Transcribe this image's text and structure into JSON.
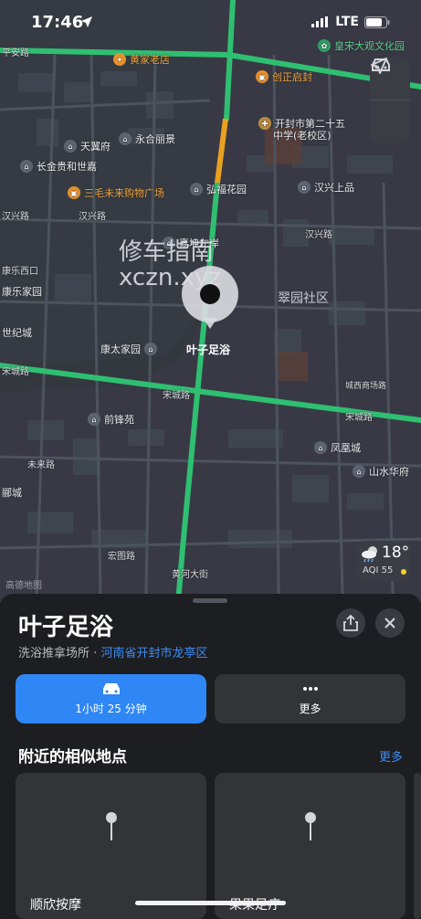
{
  "status_bar": {
    "time": "17:46",
    "network": "LTE"
  },
  "map": {
    "watermark_line1": "修车指南",
    "watermark_line2": "xczn.xyz",
    "pin_label": "叶子足浴",
    "legal": "高德地图",
    "pois": [
      {
        "label": "黄家老店",
        "style": "orange"
      },
      {
        "label": "皇宋大观文化园",
        "style": "green"
      },
      {
        "label": "创正启封",
        "style": "orange"
      },
      {
        "label": "开封市第二十五",
        "style": "normal"
      },
      {
        "label": "中学(老校区)",
        "style": "normal"
      },
      {
        "label": "天翼府",
        "style": "normal"
      },
      {
        "label": "永合丽景",
        "style": "normal"
      },
      {
        "label": "长金贵和世嘉",
        "style": "normal"
      },
      {
        "label": "三毛未来购物广场",
        "style": "orange"
      },
      {
        "label": "弘福花园",
        "style": "normal"
      },
      {
        "label": "汉兴上品",
        "style": "normal"
      },
      {
        "label": "嘉坤左岸",
        "style": "normal"
      },
      {
        "label": "康乐家园",
        "style": "normal"
      },
      {
        "label": "世纪城",
        "style": "normal"
      },
      {
        "label": "康太家园",
        "style": "normal"
      },
      {
        "label": "前锋苑",
        "style": "normal"
      },
      {
        "label": "凤凰城",
        "style": "normal"
      },
      {
        "label": "山水华府",
        "style": "normal"
      },
      {
        "label": "郦城",
        "style": "normal"
      }
    ],
    "roads": [
      "平安路",
      "汉兴路",
      "汉兴路",
      "康乐西口",
      "宋城路",
      "宋城路",
      "宋城路",
      "城西商场路",
      "未来路",
      "黄河大街",
      "宏图路",
      "汉兴路"
    ],
    "areas": [
      "翠园社区"
    ],
    "weather": {
      "temp": "18°",
      "aqi": "AQI 55"
    }
  },
  "sheet": {
    "title": "叶子足浴",
    "category": "洗浴推拿场所",
    "separator": "·",
    "location_link": "河南省开封市龙亭区",
    "directions_label": "1小时 25 分钟",
    "more_label": "更多",
    "section_title": "附近的相似地点",
    "section_more": "更多",
    "cards": [
      {
        "name": "顺欣按摩"
      },
      {
        "name": "果果足疗"
      }
    ]
  },
  "colors": {
    "accent": "#2f86f5",
    "road_major": "#2fbf71",
    "road_warning": "#e8a020",
    "map_bg": "#33383f",
    "sheet_bg": "#1d1e21"
  }
}
